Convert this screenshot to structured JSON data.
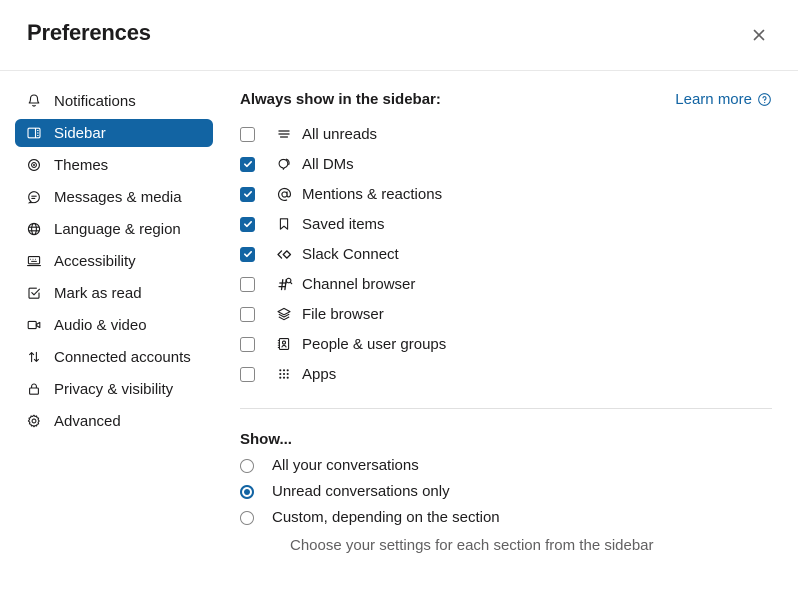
{
  "header": {
    "title": "Preferences",
    "close_icon": "close-icon"
  },
  "sidebar": {
    "items": [
      {
        "label": "Notifications",
        "icon": "bell-icon",
        "selected": false
      },
      {
        "label": "Sidebar",
        "icon": "sidebar-panel-icon",
        "selected": true
      },
      {
        "label": "Themes",
        "icon": "eye-icon",
        "selected": false
      },
      {
        "label": "Messages & media",
        "icon": "chat-bubble-icon",
        "selected": false
      },
      {
        "label": "Language & region",
        "icon": "globe-icon",
        "selected": false
      },
      {
        "label": "Accessibility",
        "icon": "keyboard-icon",
        "selected": false
      },
      {
        "label": "Mark as read",
        "icon": "check-square-icon",
        "selected": false
      },
      {
        "label": "Audio & video",
        "icon": "video-camera-icon",
        "selected": false
      },
      {
        "label": "Connected accounts",
        "icon": "arrows-up-down-icon",
        "selected": false
      },
      {
        "label": "Privacy & visibility",
        "icon": "lock-icon",
        "selected": false
      },
      {
        "label": "Advanced",
        "icon": "gear-icon",
        "selected": false
      }
    ]
  },
  "main": {
    "section_title": "Always show in the sidebar:",
    "learn_more": {
      "label": "Learn more",
      "icon": "question-circle-icon"
    },
    "checkboxes": [
      {
        "label": "All unreads",
        "icon": "unreads-lines-icon",
        "checked": false
      },
      {
        "label": "All DMs",
        "icon": "dm-faces-icon",
        "checked": true
      },
      {
        "label": "Mentions & reactions",
        "icon": "at-sign-icon",
        "checked": true
      },
      {
        "label": "Saved items",
        "icon": "bookmark-icon",
        "checked": true
      },
      {
        "label": "Slack Connect",
        "icon": "slack-connect-diamond-icon",
        "checked": true
      },
      {
        "label": "Channel browser",
        "icon": "hash-search-icon",
        "checked": false
      },
      {
        "label": "File browser",
        "icon": "layers-icon",
        "checked": false
      },
      {
        "label": "People & user groups",
        "icon": "contact-card-icon",
        "checked": false
      },
      {
        "label": "Apps",
        "icon": "grid-dots-icon",
        "checked": false
      }
    ],
    "show_section": {
      "title": "Show...",
      "options": [
        {
          "label": "All your conversations",
          "selected": false,
          "sub": ""
        },
        {
          "label": "Unread conversations only",
          "selected": true,
          "sub": ""
        },
        {
          "label": "Custom, depending on the section",
          "selected": false,
          "sub": "Choose your settings for each section from the sidebar"
        }
      ]
    }
  },
  "colors": {
    "accent": "#1264a3",
    "text": "#1d1c1d",
    "muted": "#616061",
    "border": "#e0e0e0"
  }
}
